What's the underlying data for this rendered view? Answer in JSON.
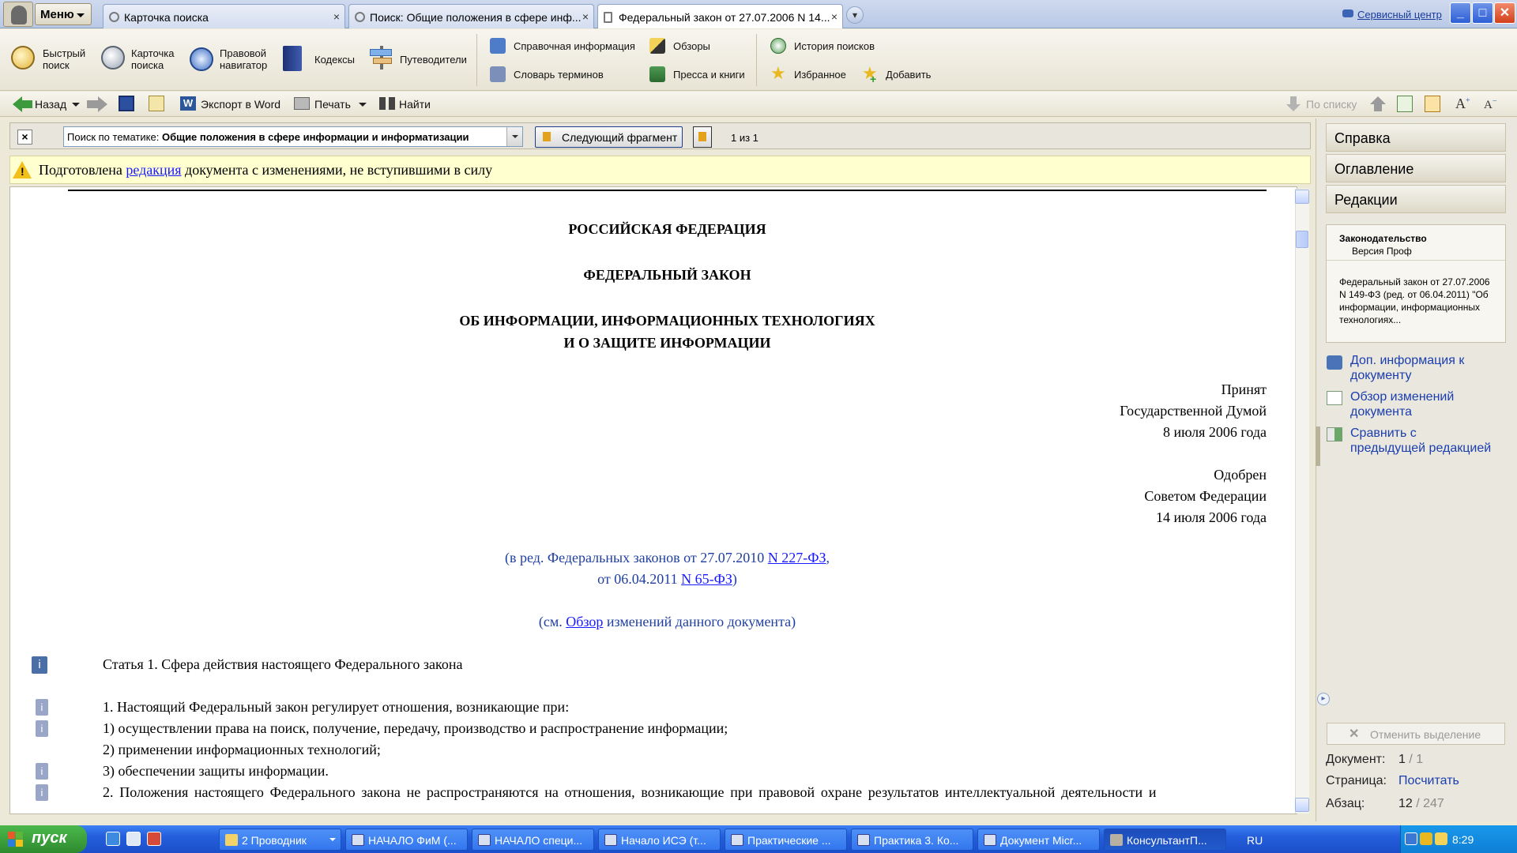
{
  "tabbar": {
    "menu_label": "Меню",
    "tabs": [
      {
        "label": "Карточка поиска",
        "close": "×"
      },
      {
        "label": "Поиск: Общие положения в сфере инф...",
        "close": "×"
      },
      {
        "label": "Федеральный закон от 27.07.2006 N 14...",
        "close": "×"
      }
    ],
    "more_glyph": "▾",
    "service_center": "Сервисный центр",
    "window_buttons": {
      "minimize": "_",
      "maximize": "□",
      "close": "✕"
    }
  },
  "toolbar": {
    "big": [
      {
        "line1": "Быстрый",
        "line2": "поиск",
        "icon": "magnifier-icon"
      },
      {
        "line1": "Карточка",
        "line2": "поиска",
        "icon": "search-card-icon"
      },
      {
        "line1": "Правовой",
        "line2": "навигатор",
        "icon": "compass-icon"
      },
      {
        "line1": "Кодексы",
        "line2": "",
        "icon": "book-icon"
      },
      {
        "line1": "Путеводители",
        "line2": "",
        "icon": "signpost-icon"
      }
    ],
    "small": [
      {
        "label": "Справочная информация",
        "icon": "reference-icon"
      },
      {
        "label": "Словарь терминов",
        "icon": "dictionary-icon"
      },
      {
        "label": "Обзоры",
        "icon": "pen-icon"
      },
      {
        "label": "Пресса и книги",
        "icon": "books-icon"
      },
      {
        "label": "История поисков",
        "icon": "clock-icon"
      },
      {
        "label": "Избранное",
        "icon": "star-icon"
      },
      {
        "label": "Добавить",
        "icon": "star-add-icon"
      }
    ]
  },
  "navbar": {
    "back": "Назад",
    "export": "Экспорт в Word",
    "print": "Печать",
    "find": "Найти",
    "by_list": "По списку"
  },
  "searchbar": {
    "close": "×",
    "prefix": "Поиск по тематике: ",
    "topic": "Общие положения в сфере информации и информатизации",
    "next_fragment": "Следующий фрагмент",
    "count": "1 из 1"
  },
  "notice": {
    "before": "Подготовлена ",
    "link": "редакция",
    "after": " документа с изменениями, не вступившими в силу"
  },
  "document": {
    "country": "РОССИЙСКАЯ ФЕДЕРАЦИЯ",
    "doc_type": "ФЕДЕРАЛЬНЫЙ ЗАКОН",
    "title_line1": "ОБ ИНФОРМАЦИИ, ИНФОРМАЦИОННЫХ ТЕХНОЛОГИЯХ",
    "title_line2": "И О ЗАЩИТЕ ИНФОРМАЦИИ",
    "adopted": [
      "Принят",
      "Государственной Думой",
      "8 июля 2006 года"
    ],
    "approved": [
      "Одобрен",
      "Советом Федерации",
      "14 июля 2006 года"
    ],
    "amend1_text": "(в ред. Федеральных законов от 27.07.2010 ",
    "amend1_link": "N 227-ФЗ",
    "amend1_end": ",",
    "amend2_text": "от 06.04.2011 ",
    "amend2_link": "N 65-ФЗ",
    "amend2_end": ")",
    "review_before": "(см. ",
    "review_link": "Обзор",
    "review_after": " изменений данного документа)",
    "article1": "Статья 1. Сфера действия настоящего Федерального закона",
    "p1": "1. Настоящий Федеральный закон регулирует отношения, возникающие при:",
    "p1_1": "1) осуществлении права на поиск, получение, передачу, производство и распространение информации;",
    "p1_2": "2) применении информационных технологий;",
    "p1_3": "3) обеспечении защиты информации.",
    "p2": "2. Положения настоящего Федерального закона не распространяются на отношения, возникающие при правовой охране результатов интеллектуальной деятельности и",
    "info_glyph": "i"
  },
  "rightpanel": {
    "tabs": [
      "Справка",
      "Оглавление",
      "Редакции"
    ],
    "box_title": "Законодательство",
    "box_subtitle": "Версия Проф",
    "box_text": "Федеральный закон от 27.07.2006 N 149-ФЗ (ред. от 06.04.2011) \"Об информации, информационных технологиях...",
    "links": [
      {
        "line1": "Доп. информация к",
        "line2": "документу",
        "icon": "info-doc-icon"
      },
      {
        "line1": "Обзор изменений",
        "line2": "документа",
        "icon": "review-icon"
      },
      {
        "line1": "Сравнить с",
        "line2": "предыдущей редакцией",
        "icon": "compare-icon"
      }
    ],
    "cancel_selection": "Отменить выделение",
    "doc_label": "Документ:",
    "doc_value": "1",
    "doc_total": " / 1",
    "page_label": "Страница:",
    "page_value": "Посчитать",
    "para_label": "Абзац:",
    "para_value": "12",
    "para_total": " / 247"
  },
  "taskbar": {
    "start": "пуск",
    "tasks": [
      {
        "label": "2 Проводник",
        "icon": "folder"
      },
      {
        "label": "НАЧАЛО ФиМ (...",
        "icon": "word"
      },
      {
        "label": "НАЧАЛО специ...",
        "icon": "word"
      },
      {
        "label": "Начало ИСЭ (т...",
        "icon": "word"
      },
      {
        "label": "Практические ...",
        "icon": "word"
      },
      {
        "label": "Практика 3. Ко...",
        "icon": "word"
      },
      {
        "label": "Документ Micr...",
        "icon": "word"
      },
      {
        "label": "КонсультантП...",
        "icon": "consultant"
      }
    ],
    "lang": "RU",
    "clock": "8:29"
  }
}
